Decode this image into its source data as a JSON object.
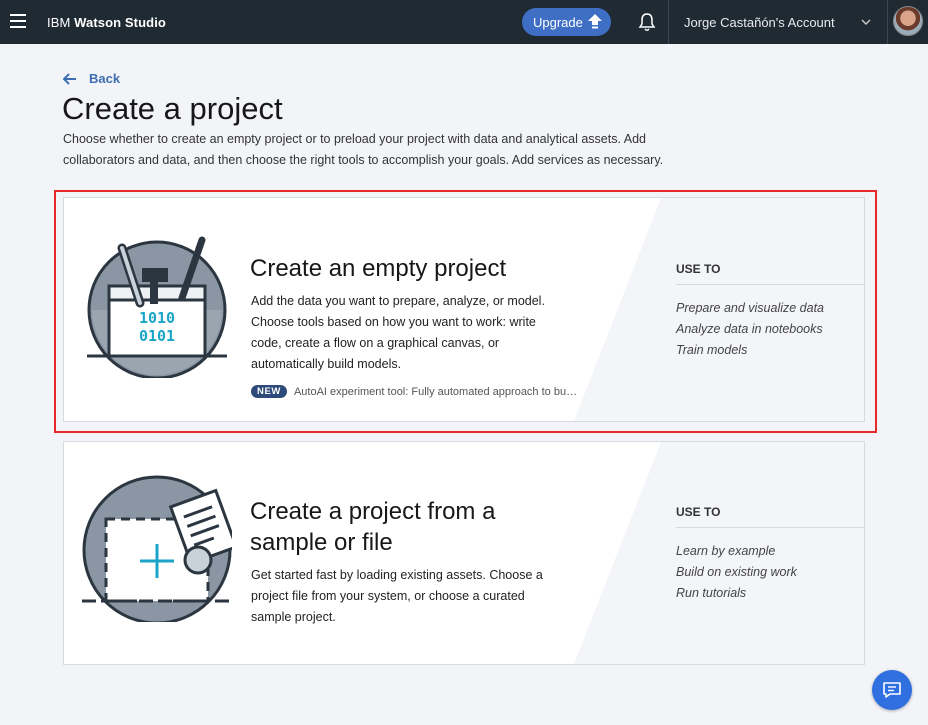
{
  "header": {
    "brand_prefix": "IBM",
    "brand_name": "Watson Studio",
    "upgrade_label": "Upgrade",
    "account_label": "Jorge Castañón's Account"
  },
  "page": {
    "back_label": "Back",
    "title": "Create a project",
    "description": "Choose whether to create an empty project or to preload your project with data and analytical assets. Add collaborators and data, and then choose the right tools to accomplish your goals. Add services as necessary."
  },
  "cards": [
    {
      "title": "Create an empty project",
      "body": "Add the data you want to prepare, analyze, or model. Choose tools based on how you want to work: write code, create a flow on a graphical canvas, or automatically build models.",
      "badge": "NEW",
      "badge_text": "AutoAI experiment tool: Fully automated approach to bu…",
      "illus_binary_1": "1010",
      "illus_binary_2": "0101",
      "use_to_label": "USE TO",
      "use_to": [
        "Prepare and visualize data",
        "Analyze data in notebooks",
        "Train models"
      ]
    },
    {
      "title_line1": "Create a project from a",
      "title_line2": "sample or file",
      "body": "Get started fast by loading existing assets. Choose a project file from your system, or choose a curated sample project.",
      "use_to_label": "USE TO",
      "use_to": [
        "Learn by example",
        "Build on existing work",
        "Run tutorials"
      ]
    }
  ],
  "colors": {
    "header_bg": "#1f2a33",
    "accent": "#3f6fc4",
    "highlight_border": "#e5282a",
    "link": "#3d6fb0"
  },
  "icons": [
    "menu-icon",
    "upload-arrow-icon",
    "bell-icon",
    "chevron-down-icon",
    "arrow-left-icon",
    "chat-icon"
  ]
}
